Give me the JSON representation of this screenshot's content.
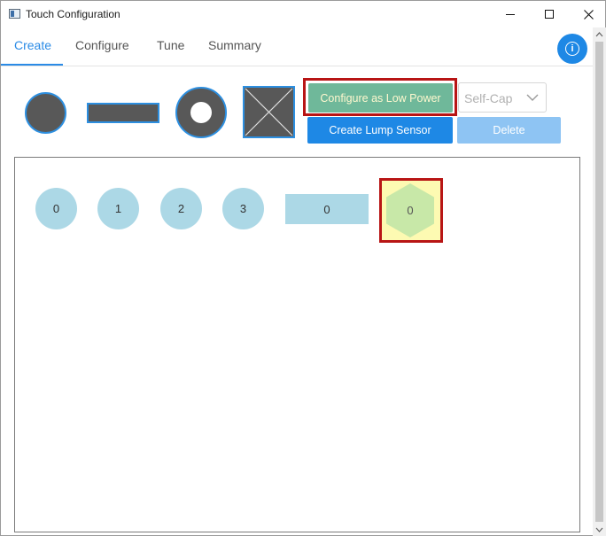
{
  "window": {
    "title": "Touch Configuration",
    "icon": "app-window-icon"
  },
  "tabs": [
    {
      "label": "Create",
      "active": true
    },
    {
      "label": "Configure",
      "active": false
    },
    {
      "label": "Tune",
      "active": false
    },
    {
      "label": "Summary",
      "active": false
    }
  ],
  "toolbar": {
    "shapes": [
      "button-shape-icon",
      "slider-shape-icon",
      "wheel-shape-icon",
      "matrix-shape-icon"
    ],
    "configure_low_power_label": "Configure as Low Power",
    "mode_select": {
      "value": "Self-Cap"
    },
    "create_lump_label": "Create Lump Sensor",
    "delete_label": "Delete"
  },
  "canvas": {
    "buttons": [
      "0",
      "1",
      "2",
      "3"
    ],
    "slider": "0",
    "lump": "0"
  },
  "colors": {
    "accent": "#1e88e5",
    "low_power_button": "#6fb89a",
    "sensor_fill": "#acd8e6",
    "highlight_frame": "#b81515",
    "lump_fill": "#c8e8a8",
    "lump_background": "#fdfab2"
  }
}
